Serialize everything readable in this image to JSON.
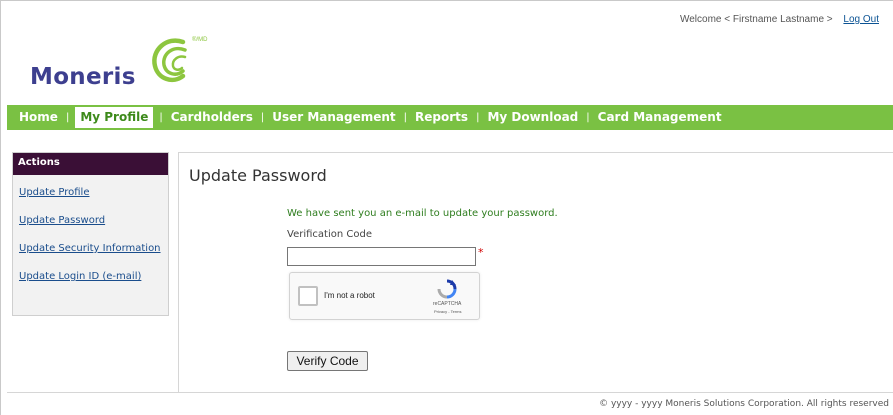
{
  "header": {
    "welcome_text": "Welcome < Firstname Lastname >",
    "logout_label": "Log Out"
  },
  "logo": {
    "text": "Moneris",
    "registered_mark": "®/MD",
    "brand_colors": {
      "text": "#3d3f8f",
      "swirl": "#8dc63f"
    }
  },
  "nav": {
    "items": [
      {
        "label": "Home",
        "active": false
      },
      {
        "label": "My Profile",
        "active": true
      },
      {
        "label": "Cardholders",
        "active": false
      },
      {
        "label": "User Management",
        "active": false
      },
      {
        "label": "Reports",
        "active": false
      },
      {
        "label": "My Download",
        "active": false
      },
      {
        "label": "Card Management",
        "active": false
      }
    ],
    "separator": "|",
    "bar_color": "#7ac143"
  },
  "sidebar": {
    "heading": "Actions",
    "items": [
      {
        "label": "Update Profile"
      },
      {
        "label": "Update Password"
      },
      {
        "label": "Update Security Information"
      },
      {
        "label": "Update Login ID (e-mail)"
      }
    ]
  },
  "main": {
    "title": "Update Password",
    "info_message": "We have sent you an e-mail to update your password.",
    "verification_label": "Verification Code",
    "verification_value": "",
    "required_mark": "*",
    "recaptcha": {
      "label": "I'm not a robot",
      "brand": "reCAPTCHA",
      "terms": "Privacy - Terms",
      "icon": "recaptcha-logo-icon"
    },
    "verify_button": "Verify Code"
  },
  "footer": {
    "copyright": "©  yyyy - yyyy  Moneris Solutions Corporation. All rights reserved"
  }
}
